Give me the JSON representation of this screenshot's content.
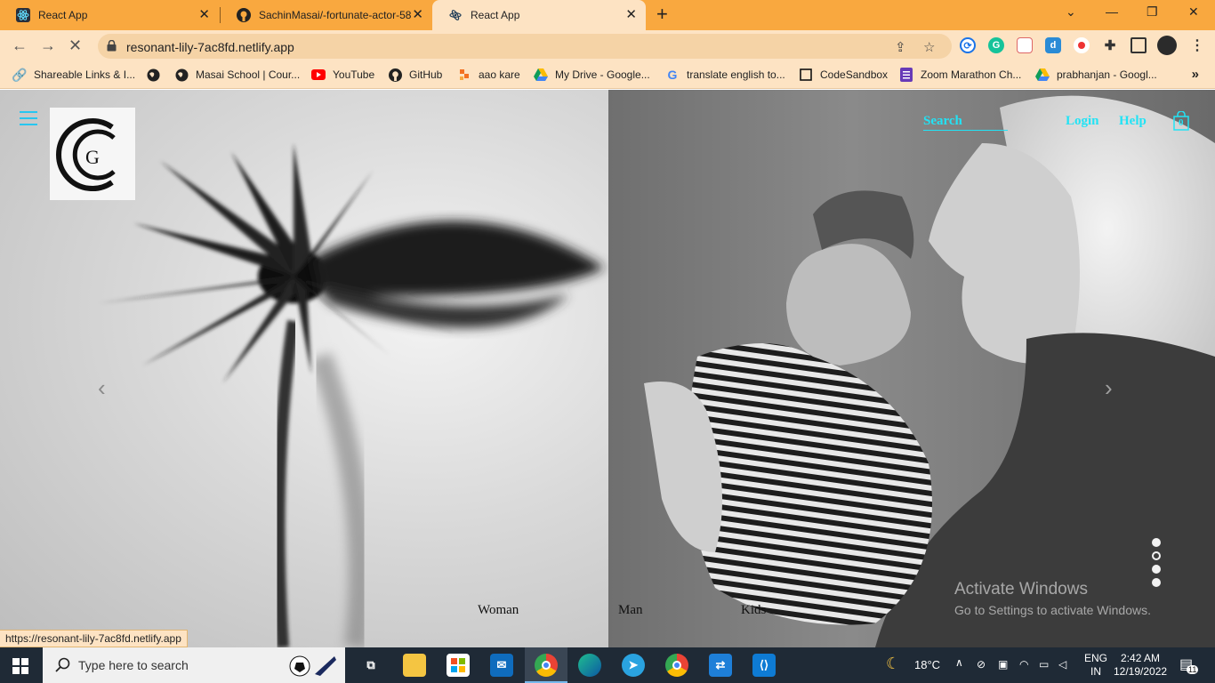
{
  "browser": {
    "tabs": [
      {
        "title": "React App",
        "active": false
      },
      {
        "title": "SachinMasai/-fortunate-actor-58",
        "active": false
      },
      {
        "title": "React App",
        "active": true
      }
    ],
    "new_tab": "+",
    "url": "resonant-lily-7ac8fd.netlify.app",
    "window_controls": {
      "collapse": "⌄",
      "minimize": "—",
      "restore": "❐",
      "close": "✕"
    }
  },
  "bookmarks": [
    {
      "label": "Shareable Links & I..."
    },
    {
      "label": ""
    },
    {
      "label": "Masai School | Cour..."
    },
    {
      "label": "YouTube"
    },
    {
      "label": "GitHub"
    },
    {
      "label": "aao kare"
    },
    {
      "label": "My Drive - Google..."
    },
    {
      "label": "translate english to..."
    },
    {
      "label": "CodeSandbox"
    },
    {
      "label": "Zoom Marathon Ch..."
    },
    {
      "label": "prabhanjan - Googl..."
    }
  ],
  "site": {
    "nav": {
      "search": "Search",
      "login": "Login",
      "help": "Help",
      "bag_count": "0"
    },
    "categories": [
      "Woman",
      "Man",
      "Kids"
    ],
    "carousel": {
      "slides": 4,
      "active_index": 1
    },
    "accent_color": "#22e3f5"
  },
  "overlay": {
    "activate_title": "Activate Windows",
    "activate_sub": "Go to Settings to activate Windows.",
    "status_url": "https://resonant-lily-7ac8fd.netlify.app"
  },
  "taskbar": {
    "search_placeholder": "Type here to search",
    "weather": "18°C",
    "lang_top": "ENG",
    "lang_bottom": "IN",
    "time": "2:42 AM",
    "date": "12/19/2022",
    "notification_count": "11"
  }
}
